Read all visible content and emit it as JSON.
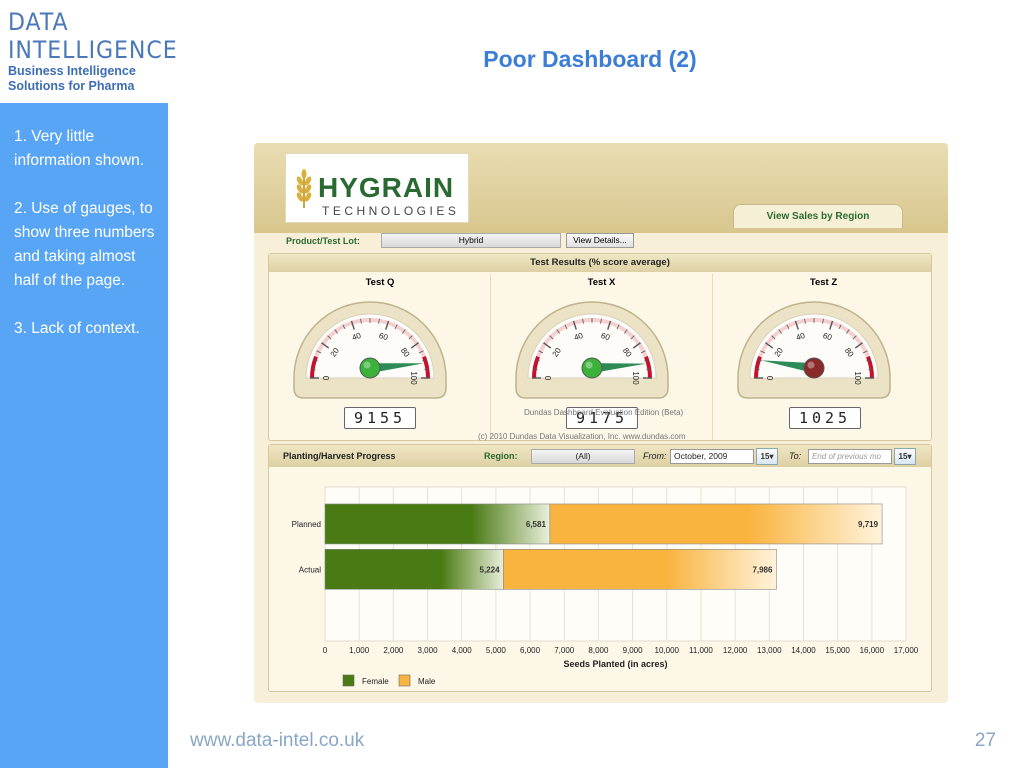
{
  "logo": {
    "line1": "DATA",
    "line2": "INTELLIGENCE",
    "line3": "Business Intelligence",
    "line4": "Solutions for Pharma"
  },
  "slide": {
    "title": "Poor Dashboard (2)",
    "footer_url": "www.data-intel.co.uk",
    "page_number": "27"
  },
  "notes": [
    "1. Very little information shown.",
    "2. Use of gauges, to show three numbers and taking almost half of the page.",
    "3. Lack of context."
  ],
  "dashboard": {
    "brand_name": "HYGRAIN",
    "brand_sub": "TECHNOLOGIES",
    "tab_label": "View Sales by Region",
    "product_lot_label": "Product/Test Lot:",
    "product_lot_value": "Hybrid",
    "view_details_label": "View Details...",
    "results_title": "Test Results (% score average)",
    "gauges": [
      {
        "title": "Test Q",
        "value": 91.55,
        "readout": "9155",
        "hub_color": "#3bb33b"
      },
      {
        "title": "Test X",
        "value": 91.75,
        "readout": "9175",
        "hub_color": "#3bb33b"
      },
      {
        "title": "Test Z",
        "value": 10.25,
        "readout": "1025",
        "hub_color": "#8a2a2a"
      }
    ],
    "gauge_ticks": [
      "0",
      "20",
      "40",
      "60",
      "80",
      "100"
    ],
    "watermark_line1": "Dundas Dashboard Evaluation Edition (Beta)",
    "watermark_line2": "(c) 2010 Dundas Data Visualization, Inc. www.dundas.com",
    "progress_title": "Planting/Harvest Progress",
    "region_label": "Region:",
    "region_value": "(All)",
    "from_label": "From:",
    "from_value": "October, 2009",
    "to_label": "To:",
    "to_placeholder": "End of previous mo",
    "calendar_day": "15"
  },
  "chart_data": {
    "type": "bar",
    "orientation": "horizontal",
    "stacked": true,
    "categories": [
      "Planned",
      "Actual"
    ],
    "series": [
      {
        "name": "Female",
        "values": [
          6581,
          5224
        ],
        "labels": [
          "6,581",
          "5,224"
        ],
        "color": "#4a7a14"
      },
      {
        "name": "Male",
        "values": [
          9719,
          7986
        ],
        "labels": [
          "9,719",
          "7,986"
        ],
        "color": "#f9b440"
      }
    ],
    "xlabel": "Seeds Planted (in acres)",
    "xlim": [
      0,
      17000
    ],
    "x_ticks": [
      "0",
      "1,000",
      "2,000",
      "3,000",
      "4,000",
      "5,000",
      "6,000",
      "7,000",
      "8,000",
      "9,000",
      "10,000",
      "11,000",
      "12,000",
      "13,000",
      "14,000",
      "15,000",
      "16,000",
      "17,000"
    ],
    "grid": true,
    "legend": "bottom-left"
  }
}
